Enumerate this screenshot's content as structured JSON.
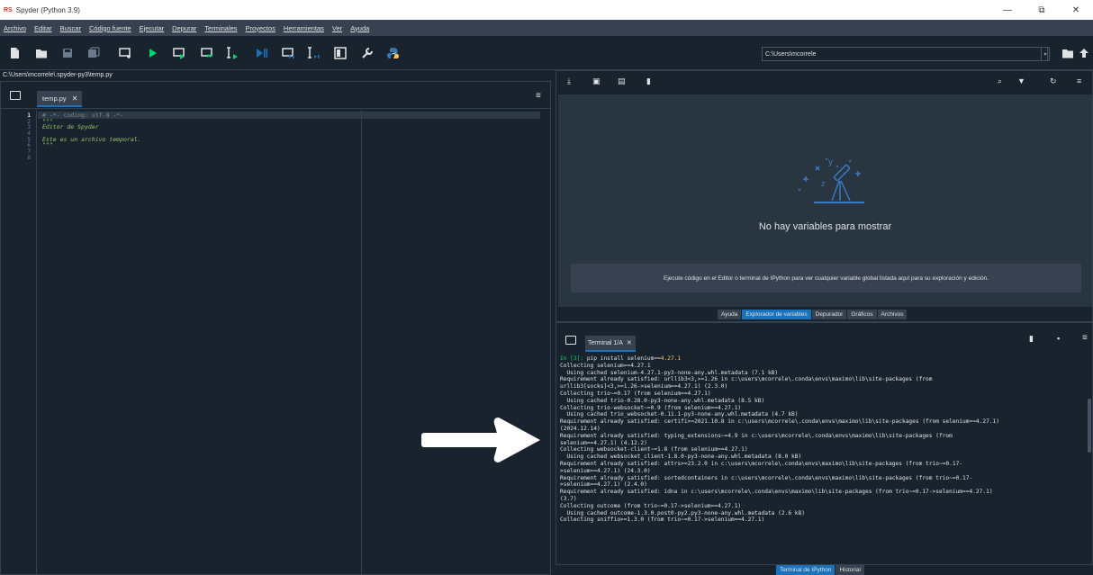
{
  "window": {
    "logo": "RS",
    "title": "Spyder (Python 3.9)",
    "controls": [
      "—",
      "⧉",
      "✕"
    ]
  },
  "menu": [
    "Archivo",
    "Editar",
    "Buscar",
    "Código fuente",
    "Ejecutar",
    "Depurar",
    "Terminales",
    "Proyectos",
    "Herramientas",
    "Ver",
    "Ayuda"
  ],
  "toolbar": {
    "cwd": "C:\\Users\\mcorrele",
    "accent": "#1a72bb",
    "run_color": "#00d36b"
  },
  "editor": {
    "path": "C:\\Users\\mcorrele\\.spyder-py3\\temp.py",
    "tab_label": "temp.py",
    "tab_close": "✕",
    "line_numbers": [
      "1",
      "2",
      "3",
      "4",
      "5",
      "6",
      "7",
      "8"
    ],
    "lines": [
      "# -*- coding: utf-8 -*-",
      "\"\"\"",
      "Editor de Spyder",
      "",
      "Este es un archivo temporal.",
      "\"\"\"",
      "",
      ""
    ]
  },
  "variable_explorer": {
    "empty_title": "No hay variables para mostrar",
    "empty_hint": "Ejecute código en el Editor o terminal de IPython para ver cualquier variable global listada aquí para su exploración y edición.",
    "tabs": [
      "Ayuda",
      "Explorador de variables",
      "Depurador",
      "Gráficos",
      "Archivos"
    ],
    "active_tab": "Explorador de variables"
  },
  "console": {
    "tab_label": "Terminal 1/A",
    "tab_close": "✕",
    "prompt": "In [3]: ",
    "command": "pip install selenium==",
    "command_version": "4.27.1",
    "output": [
      "Collecting selenium==4.27.1",
      "  Using cached selenium-4.27.1-py3-none-any.whl.metadata (7.1 kB)",
      "Requirement already satisfied: urllib3<3,>=1.26 in c:\\users\\mcorrele\\.conda\\envs\\maximo\\lib\\site-packages (from",
      "urllib3[socks]<3,>=1.26->selenium==4.27.1) (2.3.0)",
      "Collecting trio~=0.17 (from selenium==4.27.1)",
      "  Using cached trio-0.28.0-py3-none-any.whl.metadata (8.5 kB)",
      "Collecting trio-websocket~=0.9 (from selenium==4.27.1)",
      "  Using cached trio_websocket-0.11.1-py3-none-any.whl.metadata (4.7 kB)",
      "Requirement already satisfied: certifi>=2021.10.8 in c:\\users\\mcorrele\\.conda\\envs\\maximo\\lib\\site-packages (from selenium==4.27.1)",
      "(2024.12.14)",
      "Requirement already satisfied: typing_extensions~=4.9 in c:\\users\\mcorrele\\.conda\\envs\\maximo\\lib\\site-packages (from",
      "selenium==4.27.1) (4.12.2)",
      "Collecting websocket-client~=1.8 (from selenium==4.27.1)",
      "  Using cached websocket_client-1.8.0-py3-none-any.whl.metadata (8.0 kB)",
      "Requirement already satisfied: attrs>=23.2.0 in c:\\users\\mcorrele\\.conda\\envs\\maximo\\lib\\site-packages (from trio~=0.17-",
      ">selenium==4.27.1) (24.3.0)",
      "Requirement already satisfied: sortedcontainers in c:\\users\\mcorrele\\.conda\\envs\\maximo\\lib\\site-packages (from trio~=0.17-",
      ">selenium==4.27.1) (2.4.0)",
      "Requirement already satisfied: idna in c:\\users\\mcorrele\\.conda\\envs\\maximo\\lib\\site-packages (from trio~=0.17->selenium==4.27.1)",
      "(3.7)",
      "Collecting outcome (from trio~=0.17->selenium==4.27.1)",
      "  Using cached outcome-1.3.0.post0-py2.py3-none-any.whl.metadata (2.6 kB)",
      "Collecting sniffio>=1.3.0 (from trio~=0.17->selenium==4.27.1)"
    ],
    "tabs": [
      "Terminal de IPython",
      "Historial"
    ],
    "active_tab": "Terminal de IPython"
  }
}
